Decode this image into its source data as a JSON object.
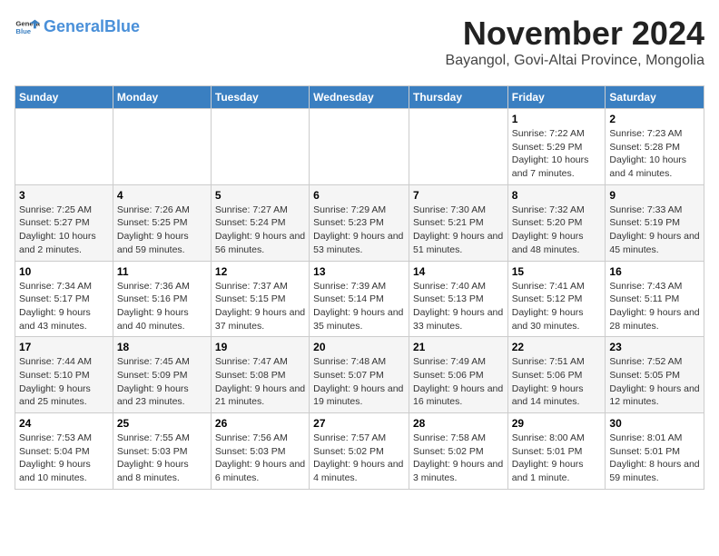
{
  "header": {
    "logo_text_general": "General",
    "logo_text_blue": "Blue",
    "month_title": "November 2024",
    "location": "Bayangol, Govi-Altai Province, Mongolia"
  },
  "weekdays": [
    "Sunday",
    "Monday",
    "Tuesday",
    "Wednesday",
    "Thursday",
    "Friday",
    "Saturday"
  ],
  "weeks": [
    [
      {
        "day": "",
        "info": ""
      },
      {
        "day": "",
        "info": ""
      },
      {
        "day": "",
        "info": ""
      },
      {
        "day": "",
        "info": ""
      },
      {
        "day": "",
        "info": ""
      },
      {
        "day": "1",
        "info": "Sunrise: 7:22 AM\nSunset: 5:29 PM\nDaylight: 10 hours and 7 minutes."
      },
      {
        "day": "2",
        "info": "Sunrise: 7:23 AM\nSunset: 5:28 PM\nDaylight: 10 hours and 4 minutes."
      }
    ],
    [
      {
        "day": "3",
        "info": "Sunrise: 7:25 AM\nSunset: 5:27 PM\nDaylight: 10 hours and 2 minutes."
      },
      {
        "day": "4",
        "info": "Sunrise: 7:26 AM\nSunset: 5:25 PM\nDaylight: 9 hours and 59 minutes."
      },
      {
        "day": "5",
        "info": "Sunrise: 7:27 AM\nSunset: 5:24 PM\nDaylight: 9 hours and 56 minutes."
      },
      {
        "day": "6",
        "info": "Sunrise: 7:29 AM\nSunset: 5:23 PM\nDaylight: 9 hours and 53 minutes."
      },
      {
        "day": "7",
        "info": "Sunrise: 7:30 AM\nSunset: 5:21 PM\nDaylight: 9 hours and 51 minutes."
      },
      {
        "day": "8",
        "info": "Sunrise: 7:32 AM\nSunset: 5:20 PM\nDaylight: 9 hours and 48 minutes."
      },
      {
        "day": "9",
        "info": "Sunrise: 7:33 AM\nSunset: 5:19 PM\nDaylight: 9 hours and 45 minutes."
      }
    ],
    [
      {
        "day": "10",
        "info": "Sunrise: 7:34 AM\nSunset: 5:17 PM\nDaylight: 9 hours and 43 minutes."
      },
      {
        "day": "11",
        "info": "Sunrise: 7:36 AM\nSunset: 5:16 PM\nDaylight: 9 hours and 40 minutes."
      },
      {
        "day": "12",
        "info": "Sunrise: 7:37 AM\nSunset: 5:15 PM\nDaylight: 9 hours and 37 minutes."
      },
      {
        "day": "13",
        "info": "Sunrise: 7:39 AM\nSunset: 5:14 PM\nDaylight: 9 hours and 35 minutes."
      },
      {
        "day": "14",
        "info": "Sunrise: 7:40 AM\nSunset: 5:13 PM\nDaylight: 9 hours and 33 minutes."
      },
      {
        "day": "15",
        "info": "Sunrise: 7:41 AM\nSunset: 5:12 PM\nDaylight: 9 hours and 30 minutes."
      },
      {
        "day": "16",
        "info": "Sunrise: 7:43 AM\nSunset: 5:11 PM\nDaylight: 9 hours and 28 minutes."
      }
    ],
    [
      {
        "day": "17",
        "info": "Sunrise: 7:44 AM\nSunset: 5:10 PM\nDaylight: 9 hours and 25 minutes."
      },
      {
        "day": "18",
        "info": "Sunrise: 7:45 AM\nSunset: 5:09 PM\nDaylight: 9 hours and 23 minutes."
      },
      {
        "day": "19",
        "info": "Sunrise: 7:47 AM\nSunset: 5:08 PM\nDaylight: 9 hours and 21 minutes."
      },
      {
        "day": "20",
        "info": "Sunrise: 7:48 AM\nSunset: 5:07 PM\nDaylight: 9 hours and 19 minutes."
      },
      {
        "day": "21",
        "info": "Sunrise: 7:49 AM\nSunset: 5:06 PM\nDaylight: 9 hours and 16 minutes."
      },
      {
        "day": "22",
        "info": "Sunrise: 7:51 AM\nSunset: 5:06 PM\nDaylight: 9 hours and 14 minutes."
      },
      {
        "day": "23",
        "info": "Sunrise: 7:52 AM\nSunset: 5:05 PM\nDaylight: 9 hours and 12 minutes."
      }
    ],
    [
      {
        "day": "24",
        "info": "Sunrise: 7:53 AM\nSunset: 5:04 PM\nDaylight: 9 hours and 10 minutes."
      },
      {
        "day": "25",
        "info": "Sunrise: 7:55 AM\nSunset: 5:03 PM\nDaylight: 9 hours and 8 minutes."
      },
      {
        "day": "26",
        "info": "Sunrise: 7:56 AM\nSunset: 5:03 PM\nDaylight: 9 hours and 6 minutes."
      },
      {
        "day": "27",
        "info": "Sunrise: 7:57 AM\nSunset: 5:02 PM\nDaylight: 9 hours and 4 minutes."
      },
      {
        "day": "28",
        "info": "Sunrise: 7:58 AM\nSunset: 5:02 PM\nDaylight: 9 hours and 3 minutes."
      },
      {
        "day": "29",
        "info": "Sunrise: 8:00 AM\nSunset: 5:01 PM\nDaylight: 9 hours and 1 minute."
      },
      {
        "day": "30",
        "info": "Sunrise: 8:01 AM\nSunset: 5:01 PM\nDaylight: 8 hours and 59 minutes."
      }
    ]
  ]
}
